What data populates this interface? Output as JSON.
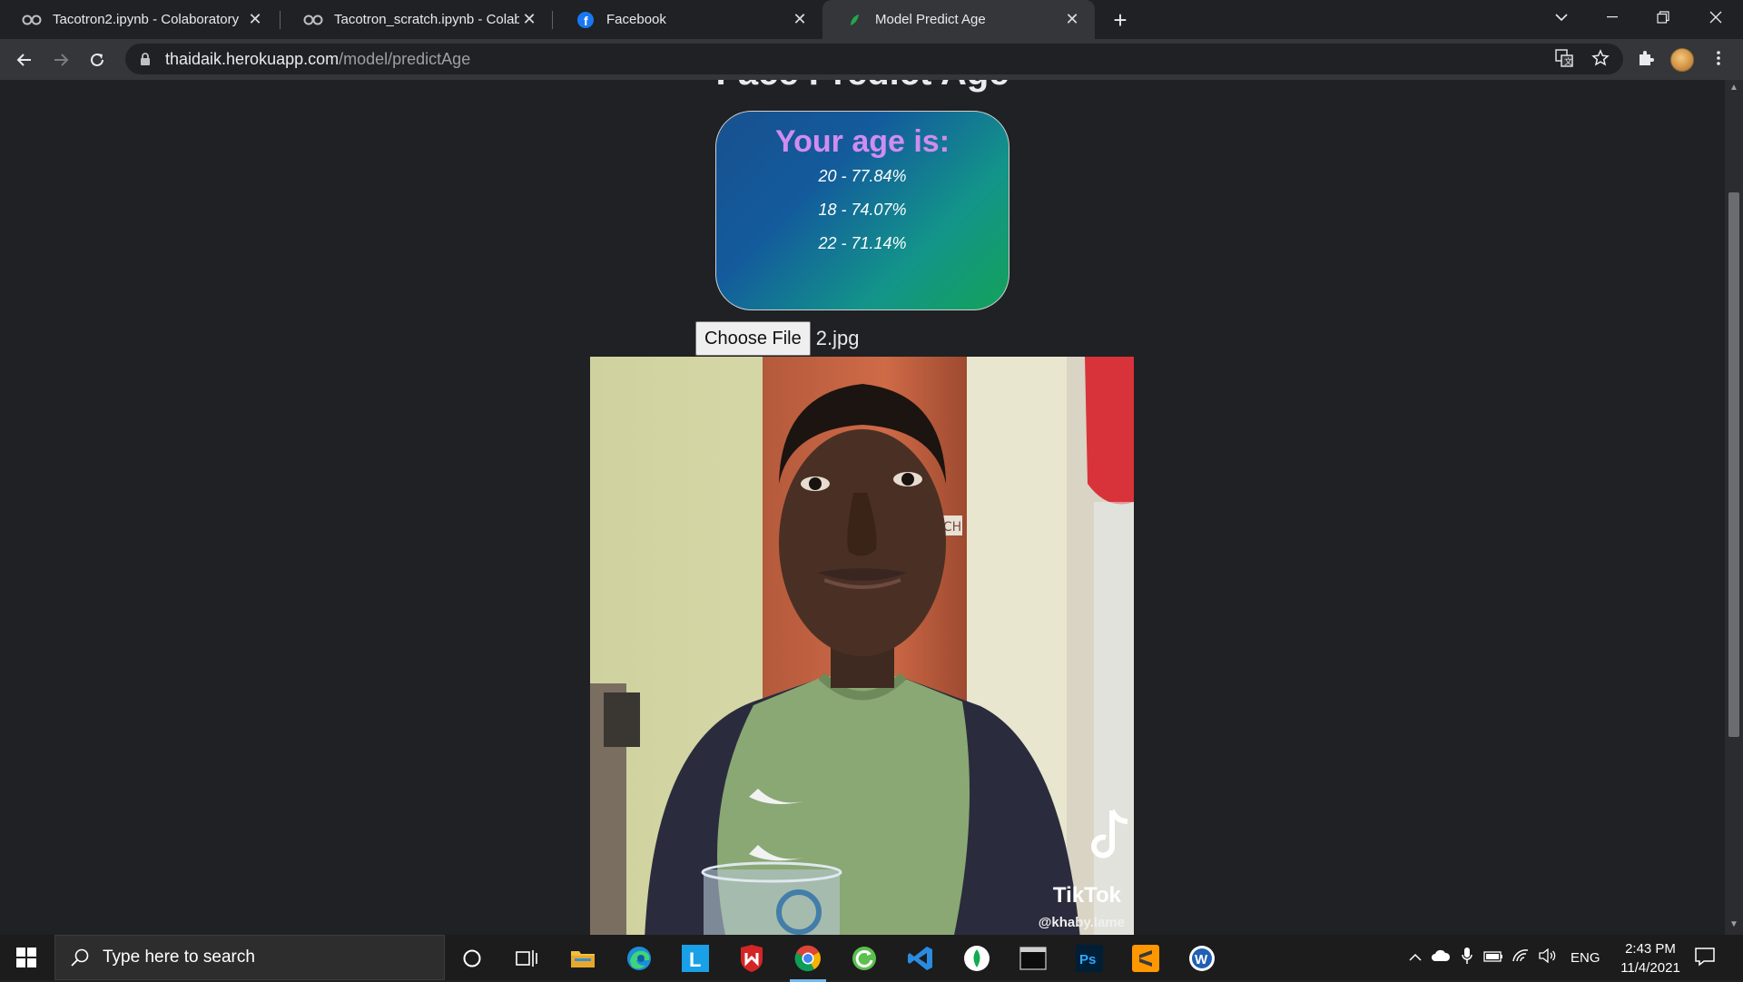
{
  "browser": {
    "tabs": [
      {
        "title": "Tacotron2.ipynb - Colaboratory",
        "icon": "colab-icon",
        "active": false
      },
      {
        "title": "Tacotron_scratch.ipynb - Colaboratory",
        "icon": "colab-icon",
        "active": false
      },
      {
        "title": "Facebook",
        "icon": "facebook-icon",
        "active": false
      },
      {
        "title": "Model Predict Age",
        "icon": "leaf-icon",
        "active": true
      }
    ],
    "url_host": "thaidaik.herokuapp.com",
    "url_path": "/model/predictAge"
  },
  "page": {
    "heading_partial": "Face Predict Age",
    "result_title": "Your age is:",
    "results": [
      "20 - 77.84%",
      "18 - 74.07%",
      "22 - 71.14%"
    ],
    "choose_file_label": "Choose File",
    "file_name": "2.jpg",
    "photo_watermark": {
      "logo": "TikTok",
      "handle": "@khaby.lame"
    },
    "colors": {
      "card_start": "#18508f",
      "card_end": "#13a25a",
      "title": "#d18cf0"
    }
  },
  "taskbar": {
    "search_placeholder": "Type here to search",
    "language": "ENG",
    "time": "2:43 PM",
    "date": "11/4/2021"
  }
}
